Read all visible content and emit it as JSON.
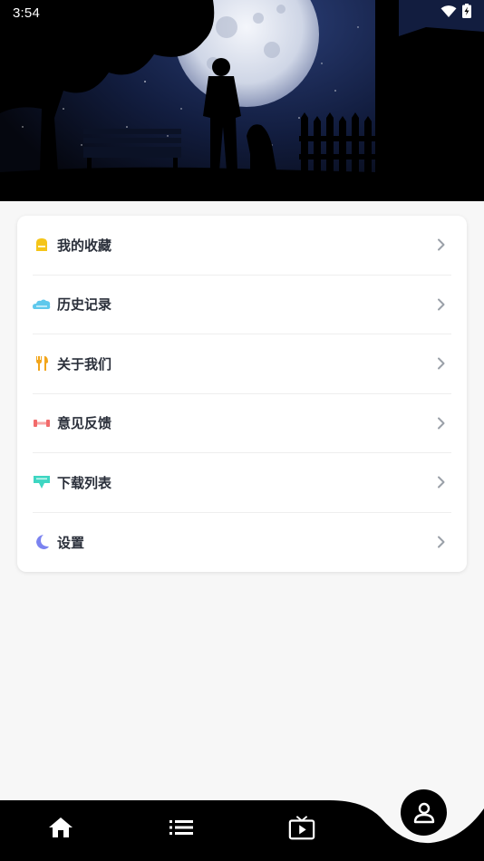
{
  "status_bar": {
    "time": "3:54",
    "icons": [
      "wifi-icon",
      "battery-charging-icon"
    ]
  },
  "hero": {
    "description_icon": "night-moon-silhouette-image"
  },
  "menu": {
    "items": [
      {
        "label": "我的收藏",
        "icon": "collection-icon",
        "color": "#f5c518"
      },
      {
        "label": "历史记录",
        "icon": "history-cloud-icon",
        "color": "#5ec8ec"
      },
      {
        "label": "关于我们",
        "icon": "about-utensils-icon",
        "color": "#f2a51a"
      },
      {
        "label": "意见反馈",
        "icon": "feedback-dumbbell-icon",
        "color": "#f26b6b"
      },
      {
        "label": "下载列表",
        "icon": "download-list-icon",
        "color": "#3ed6c2"
      },
      {
        "label": "设置",
        "icon": "settings-moon-icon",
        "color": "#7b83f0"
      }
    ],
    "chevron_icon": "chevron-right-icon"
  },
  "bottom_nav": {
    "items": [
      {
        "icon": "home-icon"
      },
      {
        "icon": "list-icon"
      },
      {
        "icon": "tv-icon"
      },
      {
        "icon": "profile-icon",
        "active": true
      }
    ]
  }
}
